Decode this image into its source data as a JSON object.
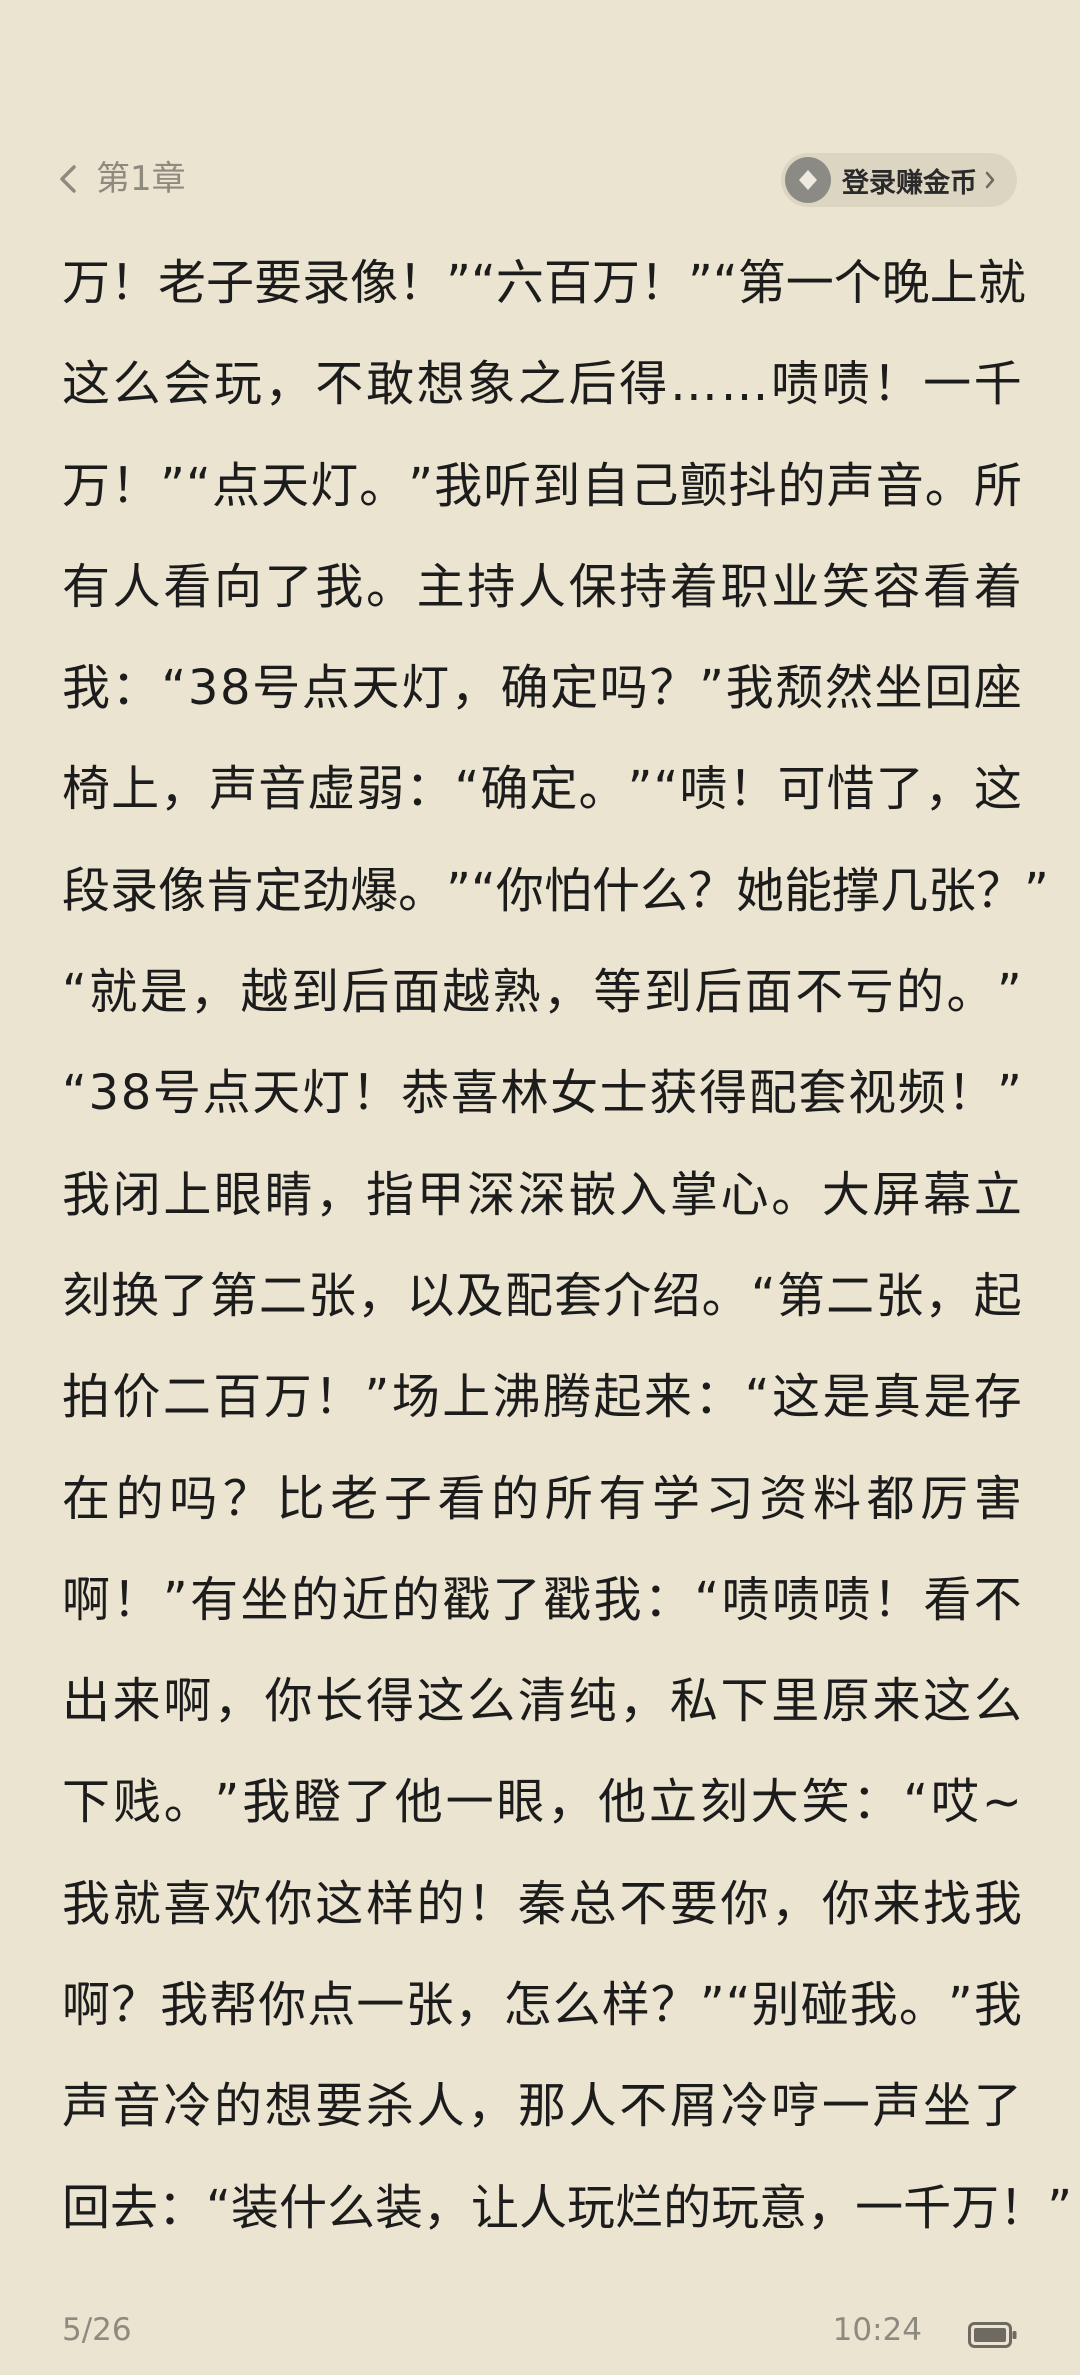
{
  "header": {
    "chapter_title": "第1章",
    "coin_button_label": "登录赚金币"
  },
  "content": {
    "lines": [
      "万！老子要录像！”“六百万！”“第一个晚上就",
      "这么会玩，不敢想象之后得……啧啧！一千",
      "万！”“点天灯。”我听到自己颤抖的声音。所",
      "有人看向了我。主持人保持着职业笑容看着",
      "我：“38号点天灯，确定吗？”我颓然坐回座",
      "椅上，声音虚弱：“确定。”“啧！可惜了，这",
      "段录像肯定劲爆。”“你怕什么？她能撑几张？”",
      "“就是，越到后面越熟，等到后面不亏的。”",
      "“38号点天灯！恭喜林女士获得配套视频！”",
      "我闭上眼睛，指甲深深嵌入掌心。大屏幕立",
      "刻换了第二张，以及配套介绍。“第二张，起",
      "拍价二百万！”场上沸腾起来：“这是真是存",
      "在的吗？比老子看的所有学习资料都厉害",
      "啊！”有坐的近的戳了戳我：“啧啧啧！看不",
      "出来啊，你长得这么清纯，私下里原来这么",
      "下贱。”我瞪了他一眼，他立刻大笑：“哎~",
      "我就喜欢你这样的！秦总不要你，你来找我",
      "啊？我帮你点一张，怎么样？”“别碰我。”我",
      "声音冷的想要杀人，那人不屑冷哼一声坐了",
      "回去：“装什么装，让人玩烂的玩意，一千万！”"
    ]
  },
  "footer": {
    "page": "5/26",
    "time": "10:24"
  },
  "colors": {
    "background": "#ebe4d1",
    "text": "#1c1c1c",
    "muted": "#8e8a80",
    "button_bg": "#dcd5c2",
    "coin_icon": "#8c8a85"
  },
  "icons": {
    "back": "chevron-left-icon",
    "coin": "coin-diamond-icon",
    "coin_chevron": "chevron-right-icon",
    "battery": "battery-icon"
  }
}
